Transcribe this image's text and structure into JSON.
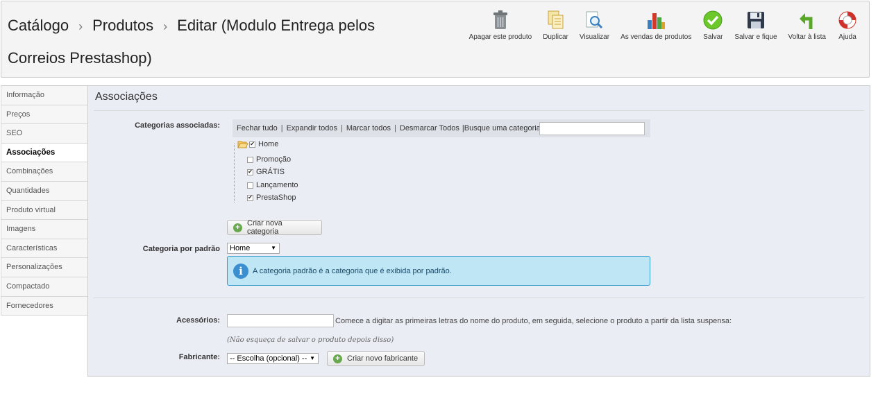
{
  "breadcrumb": {
    "items": [
      "Catálogo",
      "Produtos",
      "Editar (Modulo Entrega pelos Correios Prestashop)"
    ],
    "separator": "›"
  },
  "toolbar": [
    {
      "label": "Apagar este produto",
      "icon": "trash-icon"
    },
    {
      "label": "Duplicar",
      "icon": "duplicate-icon"
    },
    {
      "label": "Visualizar",
      "icon": "preview-icon"
    },
    {
      "label": "As vendas de produtos",
      "icon": "sales-chart-icon"
    },
    {
      "label": "Salvar",
      "icon": "save-check-icon"
    },
    {
      "label": "Salvar e fique",
      "icon": "floppy-icon"
    },
    {
      "label": "Voltar à lista",
      "icon": "back-arrow-icon"
    },
    {
      "label": "Ajuda",
      "icon": "lifebuoy-icon"
    }
  ],
  "sidebar": {
    "items": [
      {
        "label": "Informação",
        "active": false
      },
      {
        "label": "Preços",
        "active": false
      },
      {
        "label": "SEO",
        "active": false
      },
      {
        "label": "Associações",
        "active": true
      },
      {
        "label": "Combinações",
        "active": false
      },
      {
        "label": "Quantidades",
        "active": false
      },
      {
        "label": "Produto virtual",
        "active": false
      },
      {
        "label": "Imagens",
        "active": false
      },
      {
        "label": "Características",
        "active": false
      },
      {
        "label": "Personalizações",
        "active": false
      },
      {
        "label": "Compactado",
        "active": false
      },
      {
        "label": "Fornecedores",
        "active": false
      }
    ]
  },
  "main": {
    "title": "Associações",
    "categories_label": "Categorias associadas:",
    "tree_actions": [
      "Fechar tudo",
      "Expandir todos",
      "Marcar todos",
      "Desmarcar Todos"
    ],
    "search_label": "Busque uma categoria :",
    "tree": {
      "root": {
        "label": "Home",
        "checked": true
      },
      "children": [
        {
          "label": "Promoção",
          "checked": false
        },
        {
          "label": "GRÁTIS",
          "checked": true
        },
        {
          "label": "Lançamento",
          "checked": false
        },
        {
          "label": "PrestaShop",
          "checked": true
        }
      ]
    },
    "new_category_button": "Criar nova categoria",
    "default_category_label": "Categoria por padrão",
    "default_category_value": "Home",
    "info_text": "A categoria padrão é a categoria que é exibida por padrão.",
    "accessories_label": "Acessórios:",
    "accessories_hint": "Comece a digitar as primeiras letras do nome do produto, em seguida, selecione o produto a partir da lista suspensa:",
    "accessories_note": "(Não esqueça de salvar o produto depois disso)",
    "manufacturer_label": "Fabricante:",
    "manufacturer_value": "-- Escolha (opcional) --",
    "new_manufacturer_button": "Criar novo fabricante"
  },
  "colors": {
    "panel_bg": "#ebedf4",
    "info_bg": "#bee6f4",
    "info_border": "#3b9acc"
  }
}
